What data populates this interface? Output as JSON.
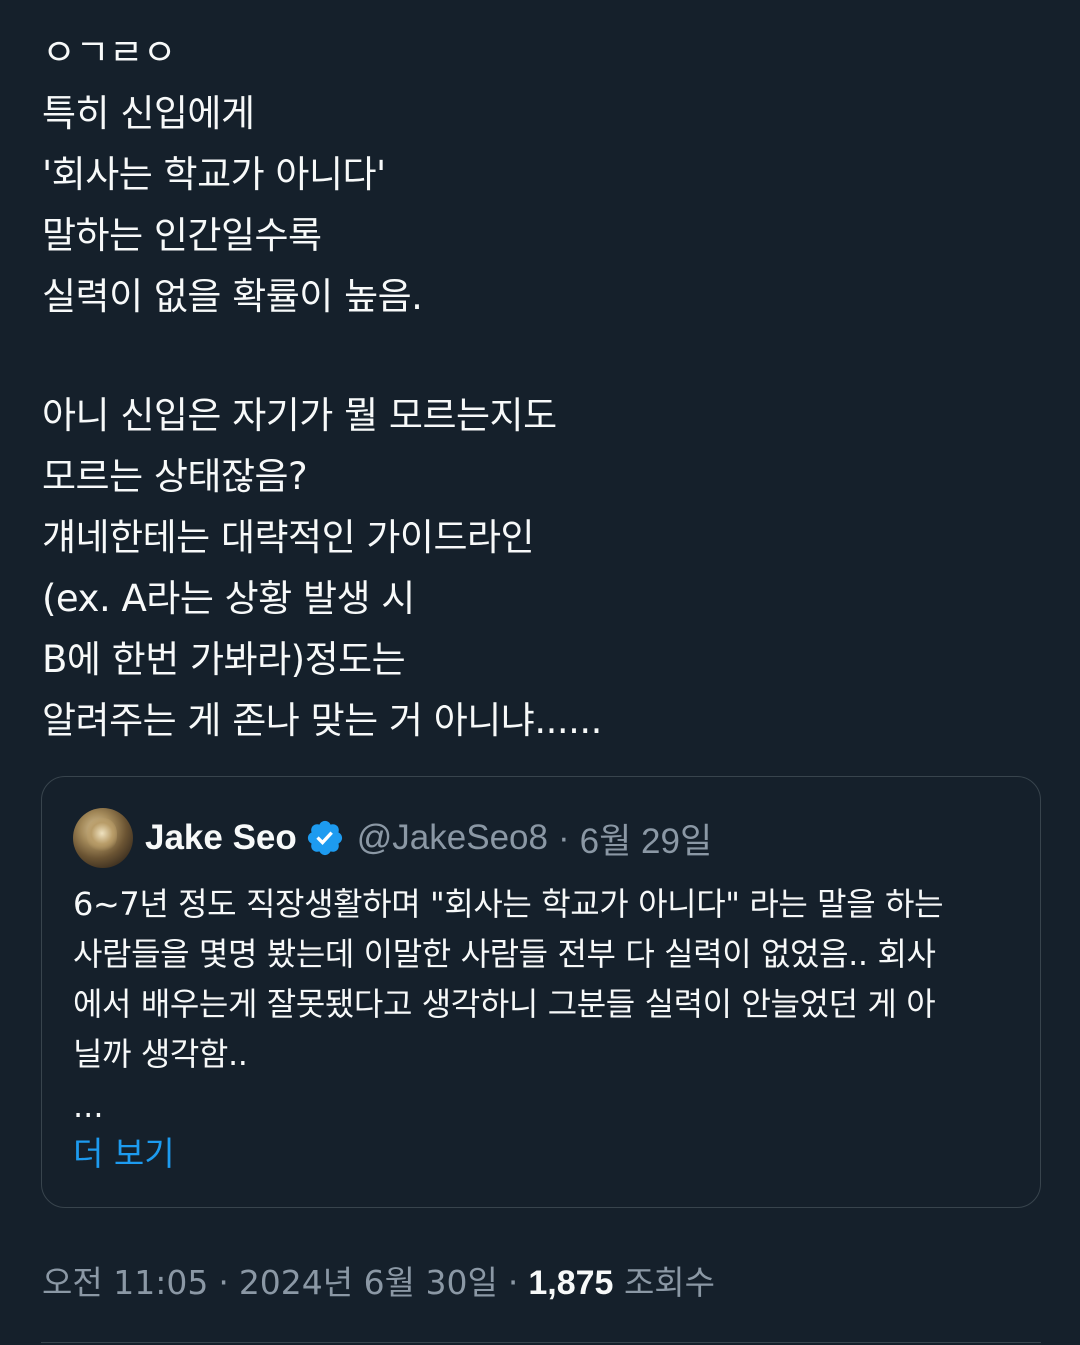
{
  "tweet": {
    "lines": [
      "ㅇㄱㄹㅇ",
      "특히 신입에게",
      "'회사는 학교가 아니다'",
      "말하는 인간일수록",
      "실력이 없을 확률이 높음.",
      "",
      "아니 신입은 자기가 뭘 모르는지도",
      "모르는 상태잖음?",
      "걔네한테는 대략적인 가이드라인",
      "(ex. A라는 상황 발생 시",
      "B에 한번 가봐라)정도는",
      "알려주는 게 존나 맞는 거 아니냐......"
    ]
  },
  "quote": {
    "author_name": "Jake Seo",
    "handle": "@JakeSeo8",
    "separator": "·",
    "date": "6월 29일",
    "text_lines": [
      "6~7년 정도 직장생활하며 \"회사는 학교가 아니다\" 라는 말을 하는",
      "사람들을 몇명 봤는데 이말한 사람들 전부 다 실력이 없었음.. 회사",
      "에서 배우는게 잘못됐다고 생각하니 그분들 실력이 안늘었던 게 아",
      "닐까 생각함.."
    ],
    "ellipsis": "...",
    "show_more": "더 보기",
    "verified_color": "#1d9bf0"
  },
  "meta": {
    "time": "오전 11:05",
    "separator": "·",
    "date": "2024년 6월 30일",
    "views_count": "1,875",
    "views_label": "조회수"
  },
  "colors": {
    "background": "#15202b",
    "text": "#f7f9f9",
    "secondary": "#8b98a5",
    "accent": "#1d9bf0",
    "border": "#38444d"
  }
}
